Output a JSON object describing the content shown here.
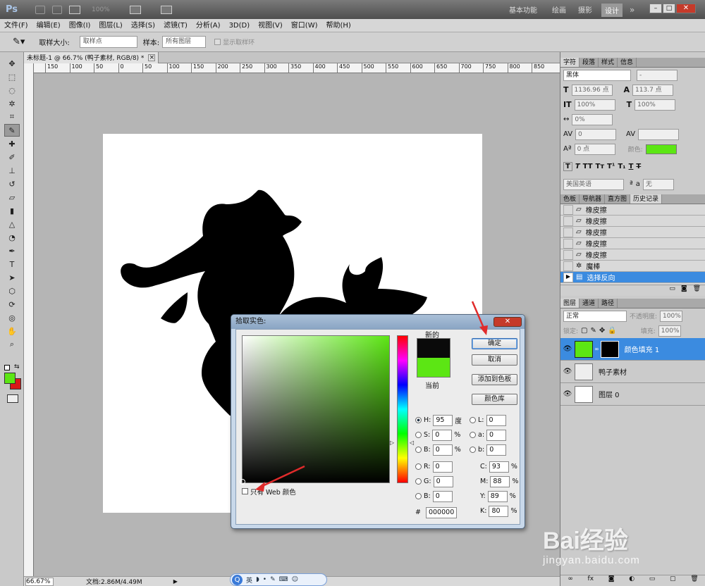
{
  "app": {
    "logo": "Ps",
    "zoom": "100%"
  },
  "workspaces": [
    "基本功能",
    "绘画",
    "摄影",
    "设计"
  ],
  "menu": [
    "文件(F)",
    "编辑(E)",
    "图像(I)",
    "图层(L)",
    "选择(S)",
    "滤镜(T)",
    "分析(A)",
    "3D(D)",
    "视图(V)",
    "窗口(W)",
    "帮助(H)"
  ],
  "options": {
    "sample_size_label": "取样大小:",
    "sample_size_value": "取样点",
    "sample_label": "样本:",
    "sample_value": "所有图层",
    "show_ring": "显示取样环"
  },
  "document": {
    "tab": "未标题-1 @ 66.7% (鸭子素材, RGB/8) *",
    "zoom": "66.67%",
    "doc_size": "文档:2.86M/4.49M"
  },
  "ruler_marks": [
    "150",
    "100",
    "50",
    "0",
    "50",
    "100",
    "150",
    "200",
    "250",
    "300",
    "350",
    "400",
    "450",
    "500",
    "550",
    "600",
    "650",
    "700",
    "750",
    "800",
    "850"
  ],
  "char_panel": {
    "tabs": [
      "字符",
      "段落",
      "样式",
      "信息"
    ],
    "font": "黑体",
    "font_style": "-",
    "size": "1136.96 点",
    "leading": "113.7 点",
    "vscale": "100%",
    "hscale": "100%",
    "tracking": "0%",
    "kerning": "0",
    "baseline": "0 点",
    "color_label": "颜色:",
    "language": "美国英语",
    "aa_label": "a",
    "aa_value": "无",
    "color_hex": "#5ce614"
  },
  "history_panel": {
    "tabs": [
      "色板",
      "导航器",
      "直方图",
      "历史记录"
    ],
    "items": [
      "橡皮擦",
      "橡皮擦",
      "橡皮擦",
      "橡皮擦",
      "橡皮擦",
      "魔棒",
      "选择反向"
    ]
  },
  "layers_panel": {
    "tabs": [
      "图层",
      "通道",
      "路径"
    ],
    "blend_mode": "正常",
    "opacity_label": "不透明度:",
    "opacity_value": "100%",
    "lock_label": "锁定:",
    "fill_label": "填充:",
    "fill_value": "100%",
    "layers": [
      "颜色填充 1",
      "鸭子素材",
      "图层 0"
    ]
  },
  "color_picker": {
    "title": "拾取实色:",
    "new_label": "新的",
    "current_label": "当前",
    "new_color": "#0a0a0a",
    "current_color": "#5ce614",
    "ok": "确定",
    "cancel": "取消",
    "add_swatch": "添加到色板",
    "libraries": "颜色库",
    "hsb": [
      {
        "label": "H:",
        "value": "95",
        "unit": "度"
      },
      {
        "label": "S:",
        "value": "0",
        "unit": "%"
      },
      {
        "label": "B:",
        "value": "0",
        "unit": "%"
      }
    ],
    "rgb": [
      {
        "label": "R:",
        "value": "0"
      },
      {
        "label": "G:",
        "value": "0"
      },
      {
        "label": "B:",
        "value": "0"
      }
    ],
    "lab": [
      {
        "label": "L:",
        "value": "0"
      },
      {
        "label": "a:",
        "value": "0"
      },
      {
        "label": "b:",
        "value": "0"
      }
    ],
    "cmyk": [
      {
        "label": "C:",
        "value": "93",
        "unit": "%"
      },
      {
        "label": "M:",
        "value": "88",
        "unit": "%"
      },
      {
        "label": "Y:",
        "value": "89",
        "unit": "%"
      },
      {
        "label": "K:",
        "value": "80",
        "unit": "%"
      }
    ],
    "hex_label": "#",
    "hex_value": "000000",
    "web_only": "只有 Web 颜色"
  },
  "ime": {
    "lang": "英"
  },
  "watermark": {
    "brand": "Bai经验",
    "url": "jingyan.baidu.com"
  }
}
